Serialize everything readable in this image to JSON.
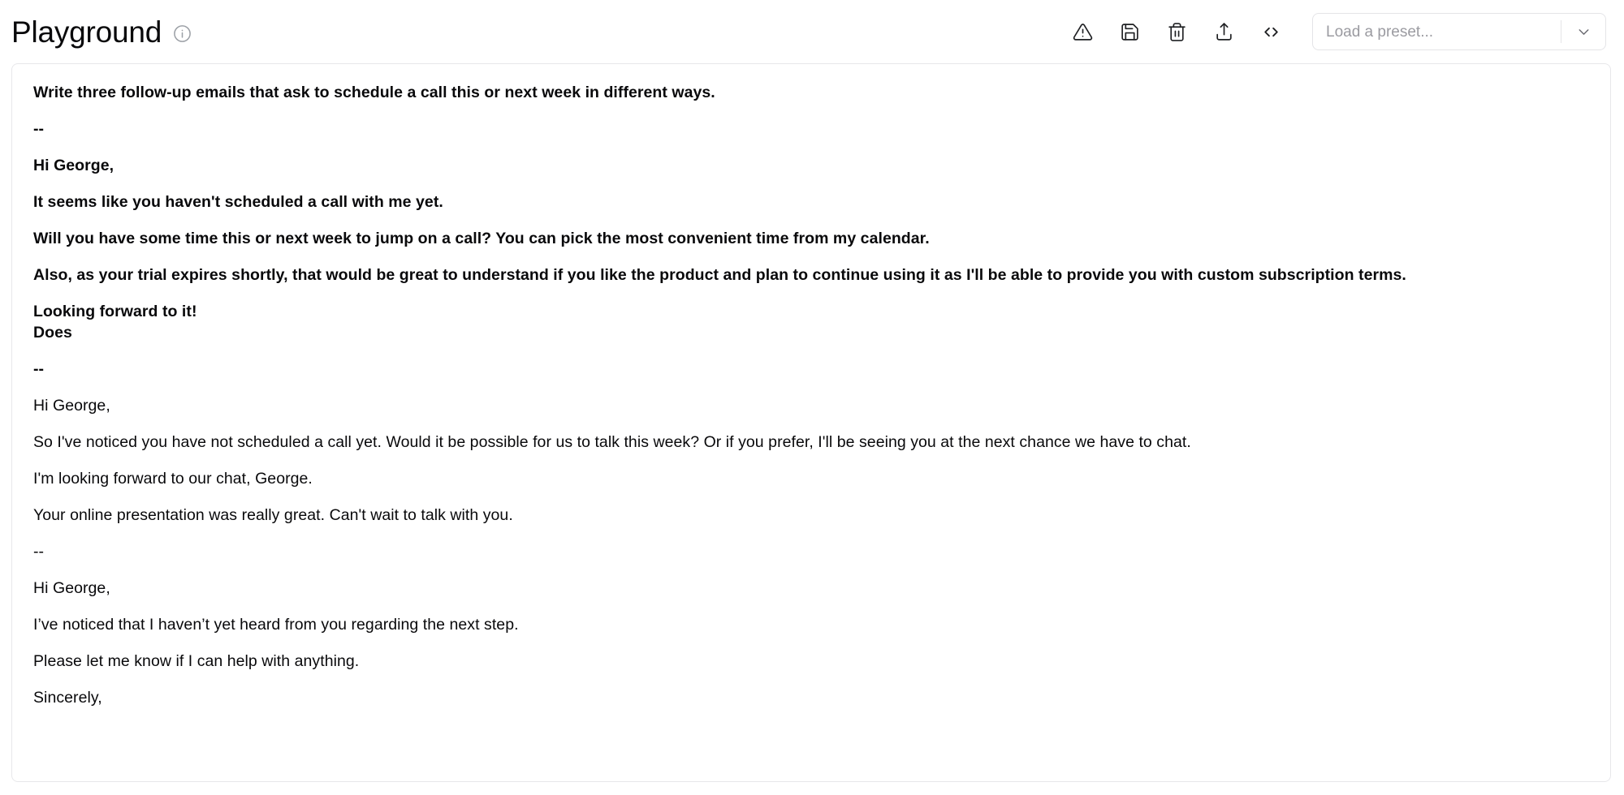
{
  "header": {
    "title": "Playground",
    "info_icon": "info-icon",
    "toolbar": [
      {
        "name": "warning-icon",
        "label": "Warning"
      },
      {
        "name": "save-icon",
        "label": "Save"
      },
      {
        "name": "trash-icon",
        "label": "Delete"
      },
      {
        "name": "share-icon",
        "label": "Share"
      },
      {
        "name": "code-icon",
        "label": "View code"
      }
    ],
    "preset": {
      "placeholder": "Load a preset...",
      "value": "",
      "chevron_icon": "chevron-down-icon"
    }
  },
  "editor": {
    "paragraphs": [
      {
        "text": "Write three follow-up emails that ask to schedule a call this or next week in different ways.",
        "bold": true
      },
      {
        "text": "--",
        "bold": true
      },
      {
        "text": "Hi George,",
        "bold": true
      },
      {
        "text": "It seems like you haven't scheduled a call with me yet.",
        "bold": true
      },
      {
        "text": "Will you have some time this or next week to jump on a call? You can pick the most convenient time from my calendar.",
        "bold": true
      },
      {
        "text": "Also, as your trial expires shortly, that would be great to understand if you like the product and plan to continue using it as I'll be able to provide you with custom subscription terms.",
        "bold": true
      },
      {
        "text": "Looking forward to it!\nDoes",
        "bold": true
      },
      {
        "text": "--",
        "bold": true
      },
      {
        "text": "Hi George,",
        "bold": false
      },
      {
        "text": "So I've noticed you have not scheduled a call yet. Would it be possible for us to talk this week? Or if you prefer, I'll be seeing you at the next chance we have to chat.",
        "bold": false
      },
      {
        "text": "I'm looking forward to our chat, George.",
        "bold": false
      },
      {
        "text": "Your online presentation was really great. Can't wait to talk with you.",
        "bold": false
      },
      {
        "text": "--",
        "bold": false
      },
      {
        "text": "Hi George,",
        "bold": false
      },
      {
        "text": "I’ve noticed that I haven’t yet heard from you regarding the next step.",
        "bold": false
      },
      {
        "text": "Please let me know if I can help with anything.",
        "bold": false
      },
      {
        "text": "Sincerely,",
        "bold": false
      }
    ]
  },
  "colors": {
    "text": "#09090b",
    "border": "#e4e4e7",
    "muted": "#9b9ba1",
    "background": "#ffffff"
  }
}
